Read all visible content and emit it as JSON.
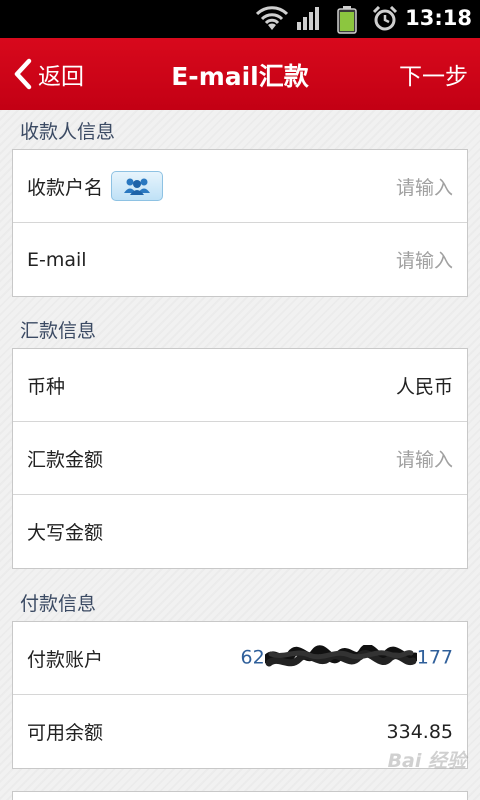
{
  "status_bar": {
    "time": "13:18",
    "icons": [
      "wifi-icon",
      "signal-icon",
      "battery-icon",
      "alarm-icon"
    ]
  },
  "header": {
    "back_label": "返回",
    "title": "E-mail汇款",
    "next_label": "下一步",
    "bar_color": "#cc0a1a"
  },
  "sections": {
    "payee": {
      "title": "收款人信息",
      "rows": [
        {
          "label": "收款户名",
          "placeholder": "请输入",
          "icon": "contacts-icon"
        },
        {
          "label": "E-mail",
          "placeholder": "请输入"
        }
      ]
    },
    "remit": {
      "title": "汇款信息",
      "rows": [
        {
          "label": "币种",
          "value": "人民币"
        },
        {
          "label": "汇款金额",
          "placeholder": "请输入"
        },
        {
          "label": "大写金额",
          "value": ""
        }
      ]
    },
    "payer": {
      "title": "付款信息",
      "rows": [
        {
          "label": "付款账户",
          "value_prefix": "62",
          "value_suffix": "177",
          "value_color": "#2f5f9a"
        },
        {
          "label": "可用余额",
          "value": "334.85"
        }
      ]
    }
  },
  "watermark": "Bai 经验"
}
